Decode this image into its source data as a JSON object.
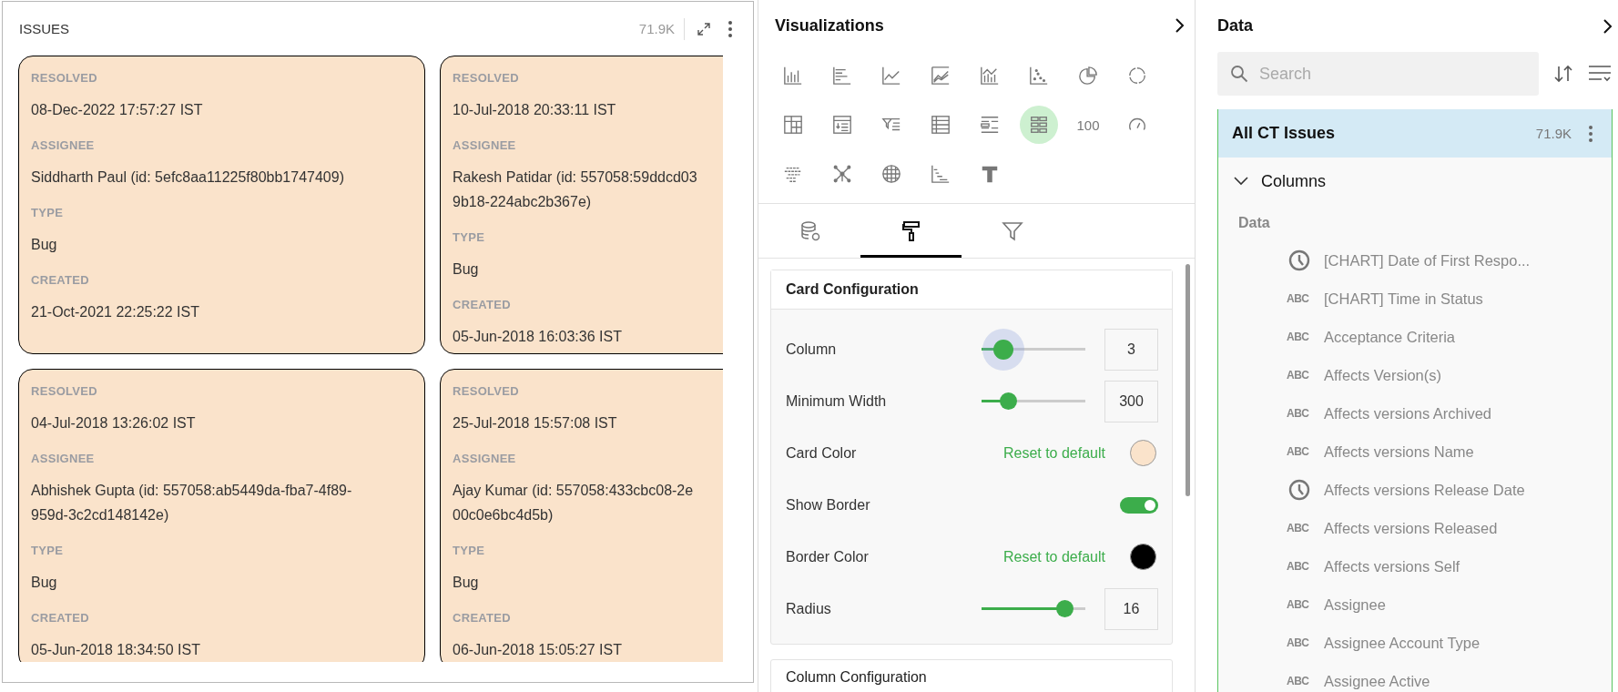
{
  "issues_panel": {
    "title": "ISSUES",
    "count": "71.9K",
    "cards": [
      {
        "fields": [
          {
            "label": "RESOLVED",
            "lines": [
              "08-Dec-2022 17:57:27 IST"
            ]
          },
          {
            "label": "ASSIGNEE",
            "lines": [
              "Siddharth Paul (id: 5efc8aa11225f80bb1747409)"
            ]
          },
          {
            "label": "TYPE",
            "lines": [
              "Bug"
            ]
          },
          {
            "label": "CREATED",
            "lines": [
              "21-Oct-2021 22:25:22 IST"
            ]
          }
        ]
      },
      {
        "fields": [
          {
            "label": "RESOLVED",
            "lines": [
              "10-Jul-2018 20:33:11 IST"
            ]
          },
          {
            "label": "ASSIGNEE",
            "lines": [
              "Rakesh Patidar (id: 557058:59ddcd03",
              "9b18-224abc2b367e)"
            ]
          },
          {
            "label": "TYPE",
            "lines": [
              "Bug"
            ]
          },
          {
            "label": "CREATED",
            "lines": [
              "05-Jun-2018 16:03:36 IST"
            ]
          }
        ]
      },
      {
        "fields": [
          {
            "label": "RESOLVED",
            "lines": [
              "04-Jul-2018 13:26:02 IST"
            ]
          },
          {
            "label": "ASSIGNEE",
            "lines": [
              "Abhishek Gupta (id: 557058:ab5449da-fba7-4f89-",
              "959d-3c2cd148142e)"
            ]
          },
          {
            "label": "TYPE",
            "lines": [
              "Bug"
            ]
          },
          {
            "label": "CREATED",
            "lines": [
              "05-Jun-2018 18:34:50 IST"
            ]
          }
        ]
      },
      {
        "fields": [
          {
            "label": "RESOLVED",
            "lines": [
              "25-Jul-2018 15:57:08 IST"
            ]
          },
          {
            "label": "ASSIGNEE",
            "lines": [
              "Ajay Kumar (id: 557058:433cbc08-2e",
              "00c0e6bc4d5b)"
            ]
          },
          {
            "label": "TYPE",
            "lines": [
              "Bug"
            ]
          },
          {
            "label": "CREATED",
            "lines": [
              "06-Jun-2018 15:05:27 IST"
            ]
          }
        ]
      }
    ]
  },
  "visualizations": {
    "title": "Visualizations",
    "types": [
      {
        "kind": "bar",
        "selected": false
      },
      {
        "kind": "hbar",
        "selected": false
      },
      {
        "kind": "line",
        "selected": false
      },
      {
        "kind": "area",
        "selected": false
      },
      {
        "kind": "combo",
        "selected": false
      },
      {
        "kind": "scatter",
        "selected": false
      },
      {
        "kind": "pie",
        "selected": false
      },
      {
        "kind": "donut",
        "selected": false
      },
      {
        "kind": "pivot",
        "selected": false
      },
      {
        "kind": "detail",
        "selected": false
      },
      {
        "kind": "funnel",
        "selected": false
      },
      {
        "kind": "table",
        "selected": false
      },
      {
        "kind": "list",
        "selected": false
      },
      {
        "kind": "cards",
        "selected": true
      },
      {
        "kind": "kpi",
        "label": "100",
        "selected": false
      },
      {
        "kind": "gauge",
        "selected": false
      },
      {
        "kind": "heatmap",
        "selected": false
      },
      {
        "kind": "network",
        "selected": false
      },
      {
        "kind": "globe",
        "selected": false
      },
      {
        "kind": "gantt",
        "selected": false
      },
      {
        "kind": "text",
        "selected": false
      }
    ],
    "tabs": [
      {
        "kind": "data",
        "selected": false
      },
      {
        "kind": "format",
        "selected": true
      },
      {
        "kind": "filter",
        "selected": false
      }
    ],
    "card_configuration": {
      "title": "Card Configuration",
      "rows": [
        {
          "kind": "slider",
          "label": "Column",
          "level": 0.21,
          "value": "3",
          "focused": true
        },
        {
          "kind": "slider",
          "label": "Minimum Width",
          "level": 0.26,
          "value": "300",
          "focused": false
        },
        {
          "kind": "color",
          "label": "Card Color",
          "link": "Reset to default",
          "color": "#fae3cb"
        },
        {
          "kind": "toggle",
          "label": "Show Border",
          "on": true
        },
        {
          "kind": "color",
          "label": "Border Color",
          "link": "Reset to default",
          "color": "#000000"
        },
        {
          "kind": "slider",
          "label": "Radius",
          "level": 0.8,
          "value": "16",
          "focused": false
        }
      ]
    },
    "column_configuration": {
      "title": "Column Configuration"
    }
  },
  "data_panel": {
    "title": "Data",
    "search": {
      "placeholder": "Search"
    },
    "source": {
      "name": "All CT Issues",
      "count": "71.9K",
      "selected": true
    },
    "columns": {
      "label": "Columns",
      "expanded": true,
      "group": "Data",
      "items": [
        {
          "kind": "date",
          "label": "[CHART] Date of First Respo..."
        },
        {
          "kind": "text",
          "badge": "ABC",
          "label": "[CHART] Time in Status"
        },
        {
          "kind": "text",
          "badge": "ABC",
          "label": "Acceptance Criteria"
        },
        {
          "kind": "text",
          "badge": "ABC",
          "label": "Affects Version(s)"
        },
        {
          "kind": "text",
          "badge": "ABC",
          "label": "Affects versions Archived"
        },
        {
          "kind": "text",
          "badge": "ABC",
          "label": "Affects versions Name"
        },
        {
          "kind": "date",
          "label": "Affects versions Release Date"
        },
        {
          "kind": "text",
          "badge": "ABC",
          "label": "Affects versions Released"
        },
        {
          "kind": "text",
          "badge": "ABC",
          "label": "Affects versions Self"
        },
        {
          "kind": "text",
          "badge": "ABC",
          "label": "Assignee"
        },
        {
          "kind": "text",
          "badge": "ABC",
          "label": "Assignee Account Type"
        },
        {
          "kind": "text",
          "badge": "ABC",
          "label": "Assignee Active"
        }
      ]
    }
  }
}
